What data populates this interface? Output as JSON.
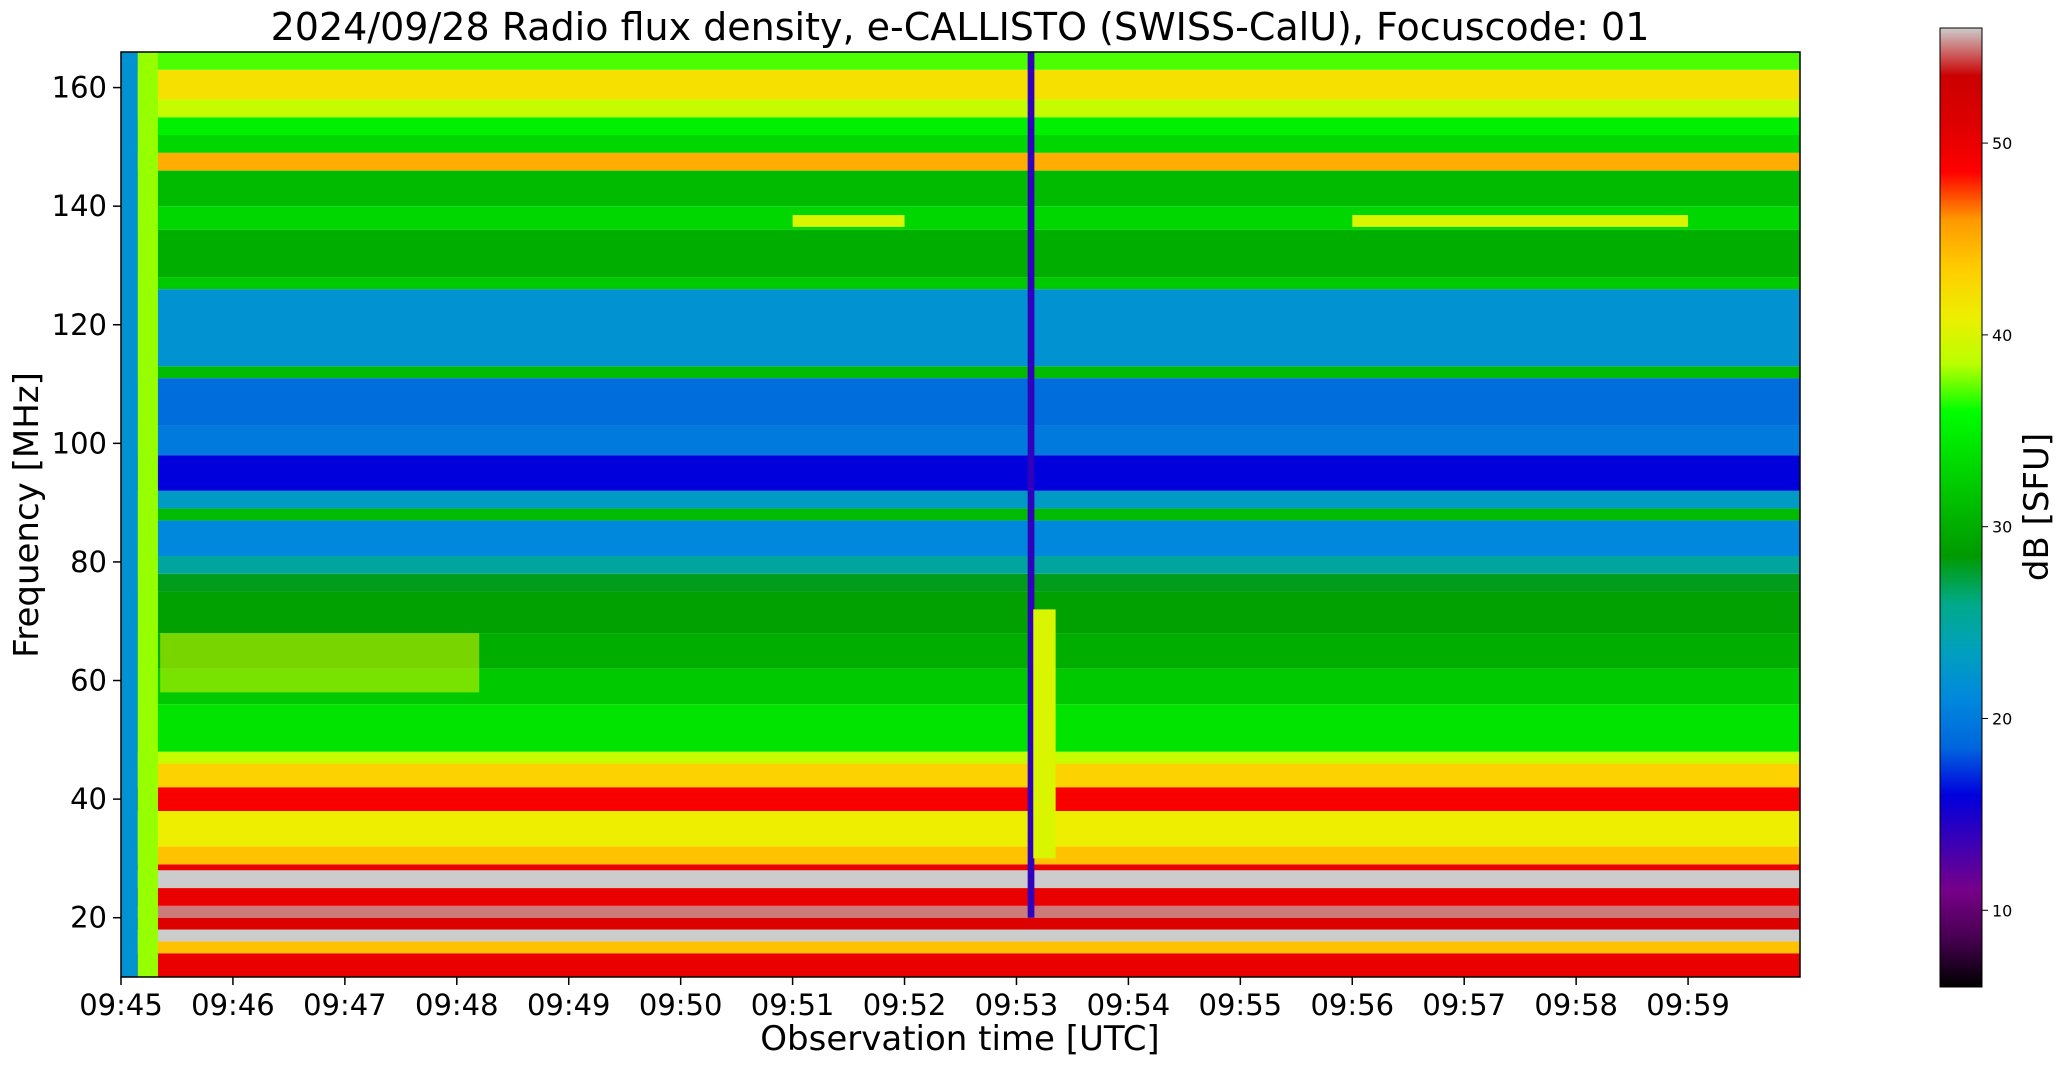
{
  "chart_data": {
    "type": "heatmap",
    "title": "2024/09/28  Radio flux density, e-CALLISTO (SWISS-CalU), Focuscode: 01",
    "xlabel": "Observation time [UTC]",
    "ylabel": "Frequency [MHz]",
    "colorbar_label": "dB [SFU]",
    "x_range_minutes": [
      0,
      15
    ],
    "x_ticks": [
      "09:45",
      "09:46",
      "09:47",
      "09:48",
      "09:49",
      "09:50",
      "09:51",
      "09:52",
      "09:53",
      "09:54",
      "09:55",
      "09:56",
      "09:57",
      "09:58",
      "09:59"
    ],
    "ylim": [
      10,
      166
    ],
    "y_ticks": [
      20,
      40,
      60,
      80,
      100,
      120,
      140,
      160
    ],
    "clim": [
      6,
      56
    ],
    "colorbar_ticks": [
      10,
      20,
      30,
      40,
      50
    ],
    "colormap": "nipy_spectral",
    "frequency_bands": [
      {
        "f0": 10,
        "f1": 14,
        "value": 50
      },
      {
        "f0": 14,
        "f1": 16,
        "value": 44
      },
      {
        "f0": 16,
        "f1": 18,
        "value": 56
      },
      {
        "f0": 18,
        "f1": 20,
        "value": 51
      },
      {
        "f0": 20,
        "f1": 22,
        "value": 55
      },
      {
        "f0": 22,
        "f1": 25,
        "value": 50
      },
      {
        "f0": 25,
        "f1": 28,
        "value": 56
      },
      {
        "f0": 28,
        "f1": 29,
        "value": 50
      },
      {
        "f0": 29,
        "f1": 32,
        "value": 44
      },
      {
        "f0": 32,
        "f1": 38,
        "value": 41
      },
      {
        "f0": 38,
        "f1": 42,
        "value": 49
      },
      {
        "f0": 42,
        "f1": 46,
        "value": 43
      },
      {
        "f0": 46,
        "f1": 48,
        "value": 39
      },
      {
        "f0": 48,
        "f1": 56,
        "value": 34
      },
      {
        "f0": 56,
        "f1": 62,
        "value": 32
      },
      {
        "f0": 62,
        "f1": 68,
        "value": 30
      },
      {
        "f0": 68,
        "f1": 75,
        "value": 29
      },
      {
        "f0": 75,
        "f1": 78,
        "value": 28
      },
      {
        "f0": 78,
        "f1": 81,
        "value": 25
      },
      {
        "f0": 81,
        "f1": 87,
        "value": 21
      },
      {
        "f0": 87,
        "f1": 89,
        "value": 31
      },
      {
        "f0": 89,
        "f1": 92,
        "value": 23
      },
      {
        "f0": 92,
        "f1": 98,
        "value": 16
      },
      {
        "f0": 98,
        "f1": 103,
        "value": 20
      },
      {
        "f0": 103,
        "f1": 111,
        "value": 19
      },
      {
        "f0": 111,
        "f1": 113,
        "value": 31
      },
      {
        "f0": 113,
        "f1": 126,
        "value": 22
      },
      {
        "f0": 126,
        "f1": 128,
        "value": 32
      },
      {
        "f0": 128,
        "f1": 136,
        "value": 30
      },
      {
        "f0": 136,
        "f1": 140,
        "value": 33
      },
      {
        "f0": 140,
        "f1": 146,
        "value": 31
      },
      {
        "f0": 146,
        "f1": 149,
        "value": 45
      },
      {
        "f0": 149,
        "f1": 152,
        "value": 33
      },
      {
        "f0": 152,
        "f1": 155,
        "value": 35
      },
      {
        "f0": 155,
        "f1": 158,
        "value": 39
      },
      {
        "f0": 158,
        "f1": 163,
        "value": 42
      },
      {
        "f0": 163,
        "f1": 166,
        "value": 37
      }
    ],
    "features": [
      {
        "name": "early columns",
        "t0": 0,
        "t1": 0.15,
        "f0": 10,
        "f1": 166,
        "value": 22
      },
      {
        "name": "early columns",
        "t0": 0.15,
        "t1": 0.33,
        "f0": 10,
        "f1": 166,
        "value": 38
      },
      {
        "name": "vertical burst",
        "t0": 8.1,
        "t1": 8.16,
        "f0": 20,
        "f1": 166,
        "value": 14
      },
      {
        "name": "vertical burst",
        "t0": 8.15,
        "t1": 8.35,
        "f0": 30,
        "f1": 72,
        "value": 40
      },
      {
        "name": "drifting lanes",
        "t0": 0.35,
        "t1": 3.2,
        "f0": 58,
        "f1": 68,
        "value": 40
      },
      {
        "name": "horizontal streak",
        "t0": 6.0,
        "t1": 7.0,
        "f0": 136.5,
        "f1": 138.5,
        "value": 40
      },
      {
        "name": "horizontal streak",
        "t0": 11.0,
        "t1": 14.0,
        "f0": 136.5,
        "f1": 138.5,
        "value": 40
      }
    ]
  }
}
